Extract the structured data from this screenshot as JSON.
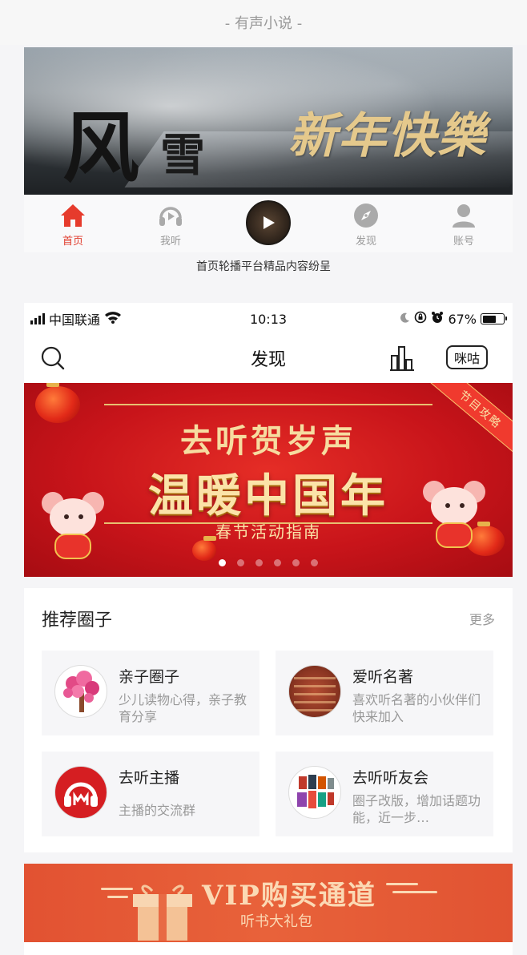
{
  "top_caption": "- 有声小说 -",
  "top_banner": {
    "ink_title_1": "风",
    "ink_title_2": "雪",
    "gold_title": "新年快樂"
  },
  "old_tabbar": {
    "tabs": [
      {
        "label": "首页",
        "icon": "home-icon",
        "active": true
      },
      {
        "label": "我听",
        "icon": "headphones-icon",
        "active": false
      },
      {
        "label": "",
        "icon": "play-icon",
        "active": false
      },
      {
        "label": "发现",
        "icon": "compass-icon",
        "active": false
      },
      {
        "label": "账号",
        "icon": "user-icon",
        "active": false
      }
    ]
  },
  "mid_caption": "首页轮播平台精品内容纷呈",
  "statusbar": {
    "carrier": "中国联通",
    "time": "10:13",
    "battery": "67%",
    "battery_level": 0.67
  },
  "navbar": {
    "title": "发现",
    "migu_label": "咪咕"
  },
  "festival_banner": {
    "line1": "去听贺岁声",
    "line2": "温暖中国年",
    "line3": "春节活动指南",
    "ribbon": "节目攻略",
    "dot_count": 6,
    "active_dot": 0
  },
  "circles": {
    "title": "推荐圈子",
    "more": "更多",
    "items": [
      {
        "name": "亲子圈子",
        "desc": "少儿读物心得，亲子教育分享"
      },
      {
        "name": "爱听名著",
        "desc": "喜欢听名著的小伙伴们快来加入"
      },
      {
        "name": "去听主播",
        "desc": "主播的交流群"
      },
      {
        "name": "去听听友会",
        "desc": "圈子改版，增加话题功能，近一步…"
      }
    ]
  },
  "vip": {
    "title": "VIP购买通道",
    "subtitle": "听书大礼包"
  },
  "colors": {
    "accent_red": "#e03b2c",
    "banner_red": "#c8141a",
    "vip_orange": "#e8623a"
  }
}
